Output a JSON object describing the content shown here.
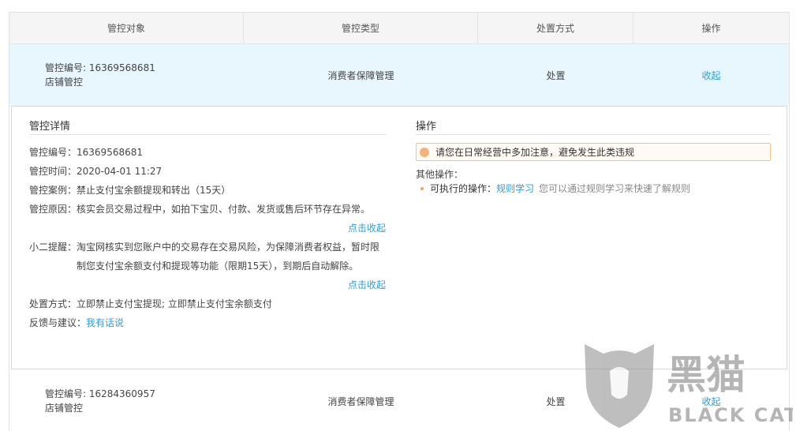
{
  "table": {
    "headers": [
      "管控对象",
      "管控类型",
      "处置方式",
      "操作"
    ],
    "rows": [
      {
        "id_label": "管控编号: 16369568681",
        "sub": "店铺管控",
        "type": "消费者保障管理",
        "method": "处置",
        "action": "收起"
      },
      {
        "id_label": "管控编号: 16284360957",
        "sub": "店铺管控",
        "type": "消费者保障管理",
        "method": "处置",
        "action": "收起"
      }
    ]
  },
  "detail": {
    "title": "管控详情",
    "id": {
      "k": "管控编号：",
      "v": "16369568681"
    },
    "time": {
      "k": "管控时间：",
      "v": "2020-04-01 11:27"
    },
    "case": {
      "k": "管控案例：",
      "v": "禁止支付宝余额提现和转出（15天）"
    },
    "reason": {
      "k": "管控原因：",
      "v": "核实会员交易过程中，如拍下宝贝、付款、发货或售后环节存在异常。"
    },
    "collapse1": "点击收起",
    "tip": {
      "k": "小二提醒：",
      "v": "淘宝网核实到您账户中的交易存在交易风险，为保障消费者权益，暂时限制您支付宝余额支付和提现等功能（限期15天），到期后自动解除。"
    },
    "collapse2": "点击收起",
    "handle": {
      "k": "处置方式：",
      "v": "立即禁止支付宝提现; 立即禁止支付宝余额支付"
    },
    "feedback": {
      "k": "反馈与建议：",
      "v": "我有话说"
    }
  },
  "ops": {
    "title": "操作",
    "notice": "请您在日常经营中多加注意，避免发生此类违规",
    "other_label": "其他操作：",
    "item_label": "可执行的操作：",
    "item_link": "规则学习",
    "item_desc": "您可以通过规则学习来快速了解规则"
  },
  "watermark": {
    "cn": "黑猫",
    "en": "BLACK CAT"
  }
}
